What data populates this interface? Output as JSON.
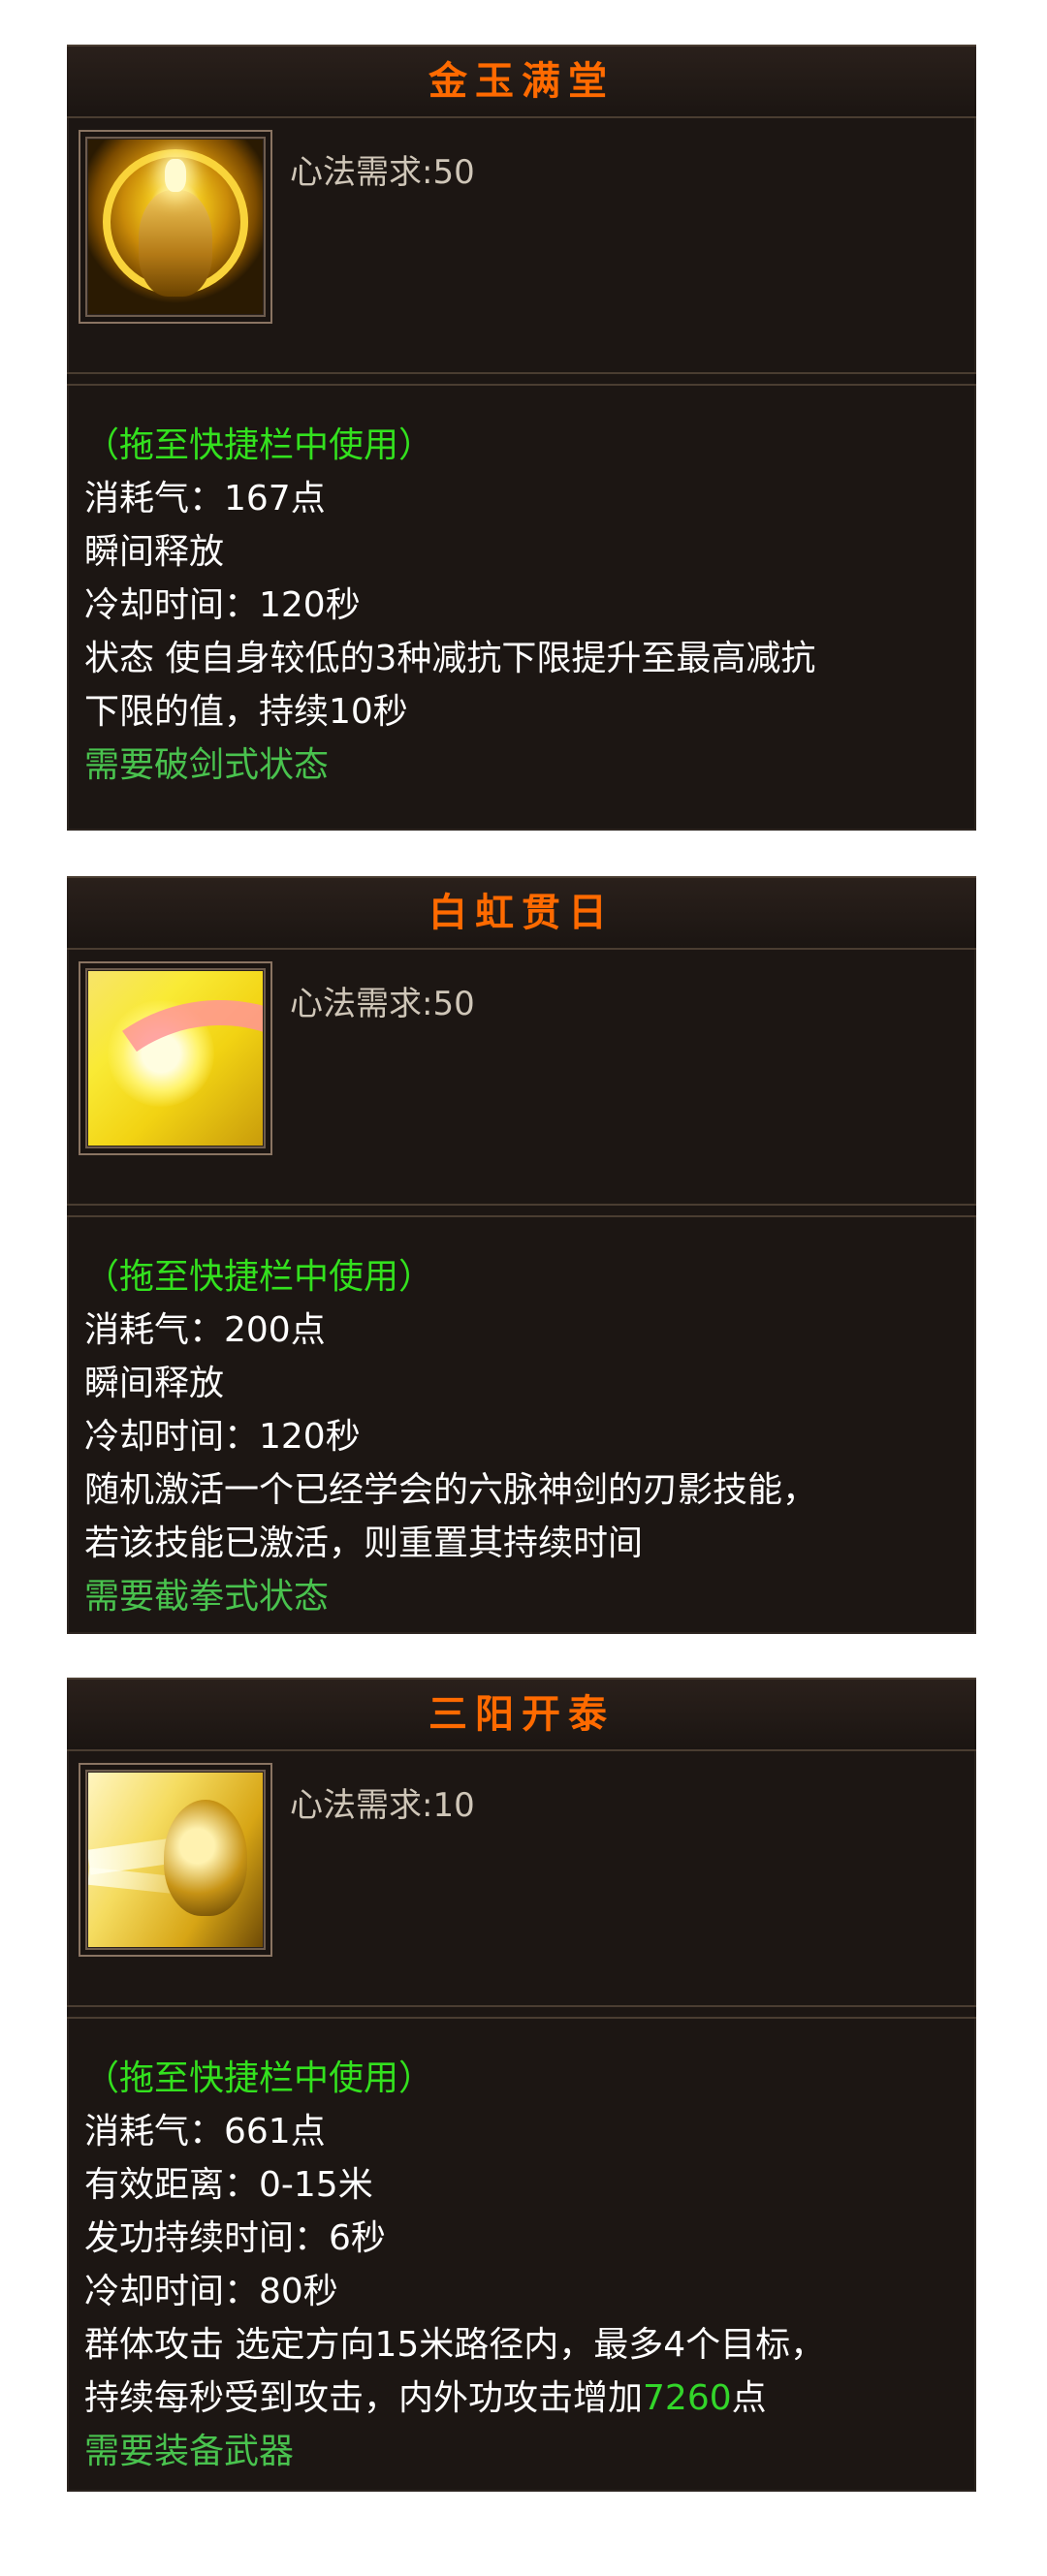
{
  "cards": [
    {
      "title": "金玉满堂",
      "icon": "golden-face-icon",
      "requirement": "心法需求:50",
      "hint": "（拖至快捷栏中使用）",
      "lines": [
        "消耗气：167点",
        "瞬间释放",
        "冷却时间：120秒",
        "状态 使自身较低的3种减抗下限提升至最高减抗",
        "下限的值，持续10秒"
      ],
      "requires_state": "需要破剑式状态"
    },
    {
      "title": "白虹贯日",
      "icon": "sun-rainbow-icon",
      "requirement": "心法需求:50",
      "hint": "（拖至快捷栏中使用）",
      "lines": [
        "消耗气：200点",
        "瞬间释放",
        "冷却时间：120秒",
        "随机激活一个已经学会的六脉神剑的刃影技能，",
        "若该技能已激活，则重置其持续时间"
      ],
      "requires_state": "需要截拳式状态"
    },
    {
      "title": "三阳开泰",
      "icon": "golden-skull-icon",
      "requirement": "心法需求:10",
      "hint": "（拖至快捷栏中使用）",
      "lines": [
        "消耗气：661点",
        "有效距离：0-15米",
        "发功持续时间：6秒",
        "冷却时间：80秒",
        "群体攻击 选定方向15米路径内，最多4个目标，"
      ],
      "last_line_prefix": "持续每秒受到攻击，内外功攻击增加",
      "last_line_value": "7260",
      "last_line_suffix": "点",
      "requires_state": "需要装备武器"
    }
  ],
  "colors": {
    "title": "#ff6a00",
    "hint": "#33e11e",
    "requirement_green": "#49c24e",
    "panel": "#1c1613"
  }
}
